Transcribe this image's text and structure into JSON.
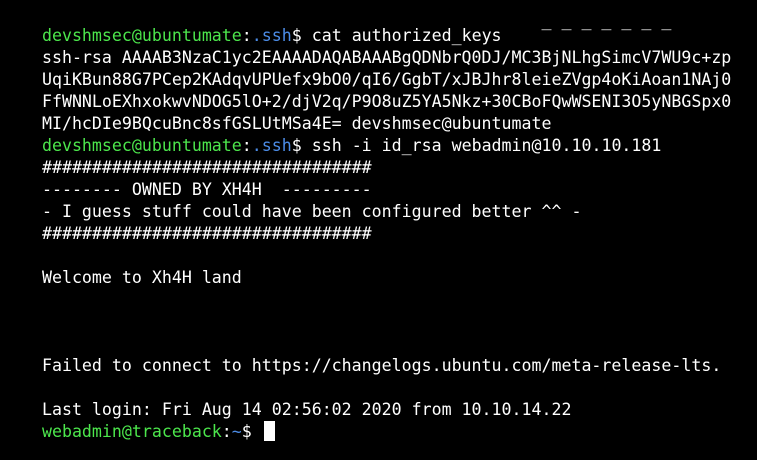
{
  "colors": {
    "background": "#000000",
    "text": "#ffffff",
    "prompt_user": "#4ce64c",
    "prompt_path": "#4c8ce6",
    "cursor": "#ffffff"
  },
  "terminal": {
    "top_partial": "                                                  _ _ _ _ _ _ _",
    "prompt1": {
      "user_host": "devshmsec@ubuntumate",
      "colon": ":",
      "path": ".ssh",
      "symbol": "$ ",
      "command": "cat authorized_keys"
    },
    "key_lines": [
      "ssh-rsa AAAAB3NzaC1yc2EAAAADAQABAAABgQDNbrQ0DJ/MC3BjNLhgSimcV7WU9c+zp",
      "UqiKBun88G7PCep2KAdqvUPUefx9bO0/qI6/GgbT/xJBJhr8leieZVgp4oKiAoan1NAj0",
      "FfWNNLoEXhxokwvNDOG5lO+2/djV2q/P9O8uZ5YA5Nkz+30CBoFQwWSENI3O5yNBGSpx0",
      "MI/hcDIe9BQcuBnc8sfGSLUtMSa4E= devshmsec@ubuntumate"
    ],
    "prompt2": {
      "user_host": "devshmsec@ubuntumate",
      "colon": ":",
      "path": ".ssh",
      "symbol": "$ ",
      "command": "ssh -i id_rsa webadmin@10.10.10.181"
    },
    "banner_lines": [
      "#################################",
      "-------- OWNED BY XH4H  ---------",
      "- I guess stuff could have been configured better ^^ -",
      "#################################"
    ],
    "welcome": "Welcome to Xh4H land",
    "failed": "Failed to connect to https://changelogs.ubuntu.com/meta-release-lts.",
    "last_login": "Last login: Fri Aug 14 02:56:02 2020 from 10.10.14.22",
    "prompt3": {
      "user_host": "webadmin@traceback",
      "colon": ":",
      "path": "~",
      "symbol": "$ "
    }
  }
}
